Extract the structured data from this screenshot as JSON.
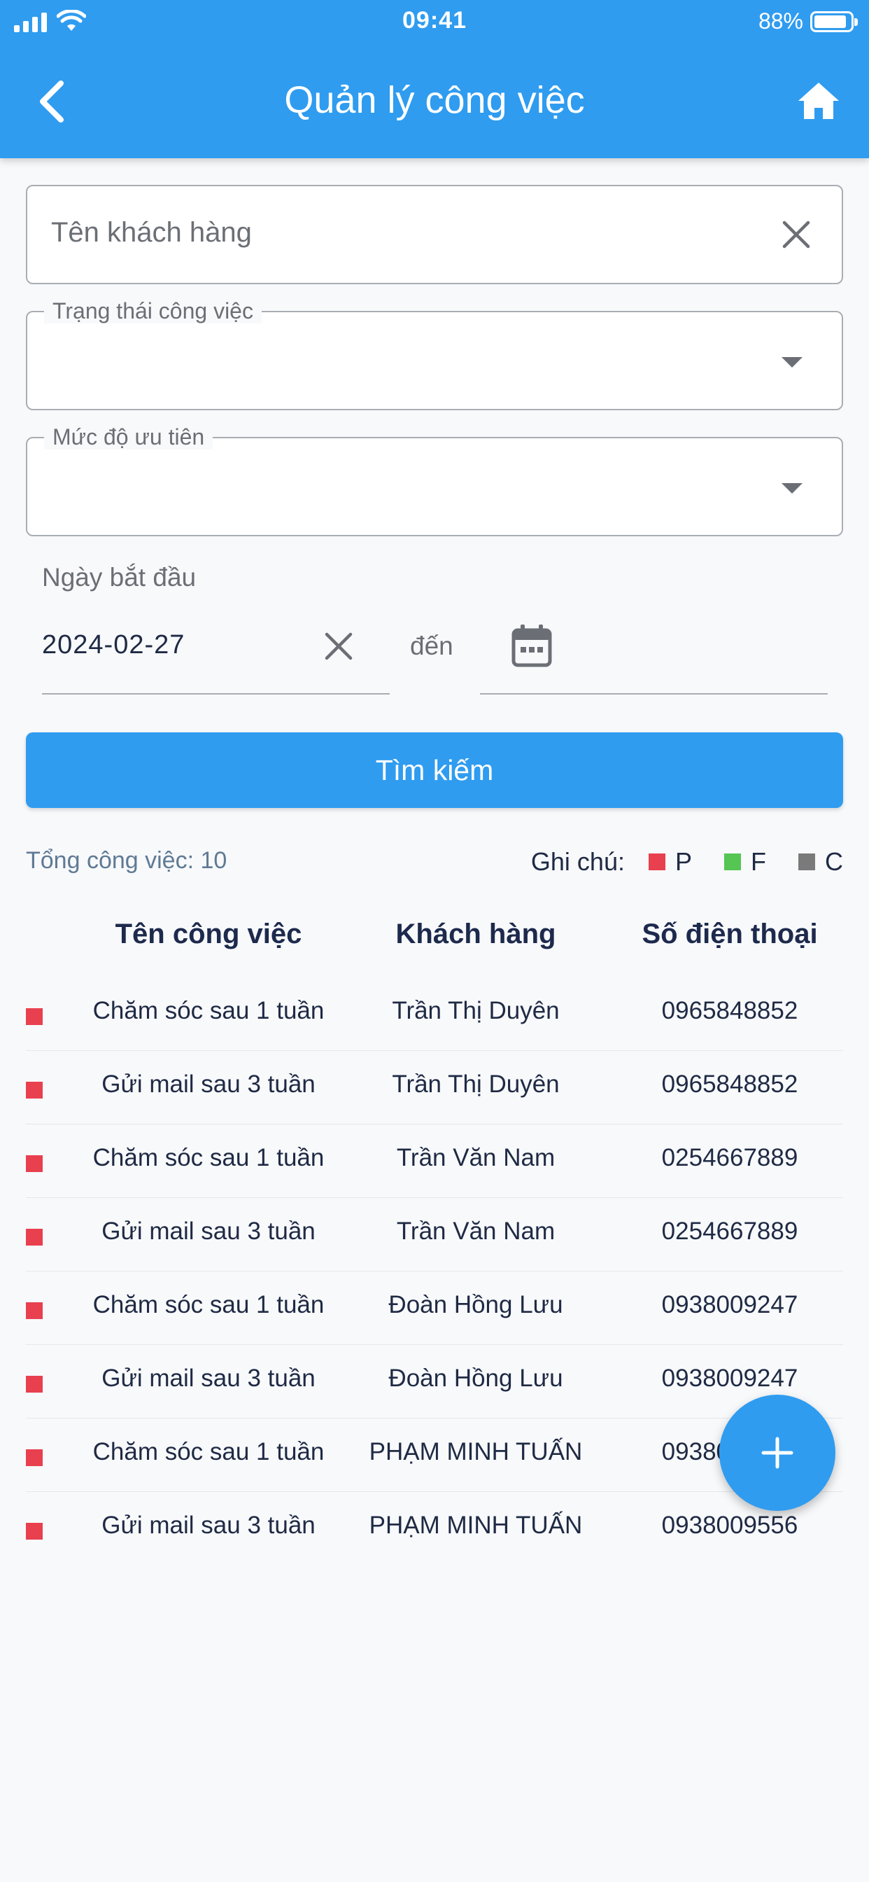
{
  "status_bar": {
    "time": "09:41",
    "battery": "88%"
  },
  "header": {
    "title": "Quản lý công việc"
  },
  "form": {
    "customer_placeholder": "Tên khách hàng",
    "status_label": "Trạng thái công việc",
    "priority_label": "Mức độ ưu tiên",
    "start_date_label": "Ngày bắt đầu",
    "start_date_value": "2024-02-27",
    "to_label": "đến",
    "search_button": "Tìm kiếm"
  },
  "summary": {
    "total_text": "Tổng công việc: 10"
  },
  "legend": {
    "title": "Ghi chú:",
    "items": [
      {
        "label": "P",
        "color": "#e8404f"
      },
      {
        "label": "F",
        "color": "#55c553"
      },
      {
        "label": "C",
        "color": "#7a7a7a"
      }
    ]
  },
  "table": {
    "headers": [
      "Tên công việc",
      "Khách hàng",
      "Số điện thoại"
    ],
    "rows": [
      {
        "task": "Chăm sóc sau 1 tuần",
        "customer": "Trần Thị Duyên",
        "phone": "0965848852",
        "status_color": "#e8404f"
      },
      {
        "task": "Gửi mail sau 3 tuần",
        "customer": "Trần Thị Duyên",
        "phone": "0965848852",
        "status_color": "#e8404f"
      },
      {
        "task": "Chăm sóc sau 1 tuần",
        "customer": "Trần Văn Nam",
        "phone": "0254667889",
        "status_color": "#e8404f"
      },
      {
        "task": "Gửi mail sau 3 tuần",
        "customer": "Trần Văn Nam",
        "phone": "0254667889",
        "status_color": "#e8404f"
      },
      {
        "task": "Chăm sóc sau 1 tuần",
        "customer": "Đoàn Hồng Lưu",
        "phone": "0938009247",
        "status_color": "#e8404f"
      },
      {
        "task": "Gửi mail sau 3 tuần",
        "customer": "Đoàn Hồng Lưu",
        "phone": "0938009247",
        "status_color": "#e8404f"
      },
      {
        "task": "Chăm sóc sau 1 tuần",
        "customer": "PHẠM MINH TUẤN",
        "phone": "0938009556",
        "status_color": "#e8404f"
      },
      {
        "task": "Gửi mail sau 3 tuần",
        "customer": "PHẠM MINH TUẤN",
        "phone": "0938009556",
        "status_color": "#e8404f"
      }
    ]
  },
  "colors": {
    "primary": "#2f9cf0"
  },
  "icons": {
    "back": "chevron-left-icon",
    "home": "home-icon",
    "clear": "close-icon",
    "dropdown": "caret-down-icon",
    "calendar": "calendar-icon",
    "fab": "plus-icon"
  }
}
